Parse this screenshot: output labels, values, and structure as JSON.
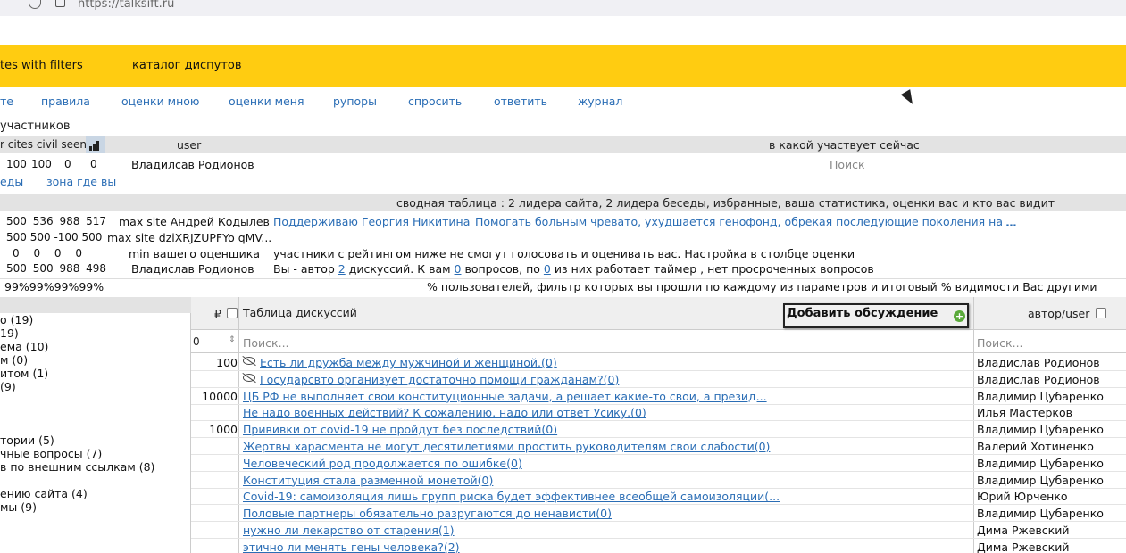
{
  "browser": {
    "url": "https://talksift.ru"
  },
  "header": {
    "item1": "tes with filters",
    "item2": "каталог диспутов"
  },
  "nav": [
    "те",
    "правила",
    "оценки мною",
    "оценки меня",
    "рупоры",
    "спросить",
    "ответить",
    "журнал"
  ],
  "participants_label": "участников",
  "stats_header": {
    "cols": "r cites civil seen",
    "user": "user",
    "current": "в какой участвует сейчас"
  },
  "stats_row": {
    "v1": "100",
    "v2": "100",
    "v3": "0",
    "v4": "0",
    "user": "Владилсав Родионов",
    "search_placeholder": "Поиск"
  },
  "subnav": {
    "a": "еды",
    "b": "зона где вы"
  },
  "summary_title": "сводная таблица : 2 лидера сайта, 2 лидера беседы, избранные, ваша статистика, оценки вас и кто вас видит",
  "summary_rows": [
    {
      "nums": "500 536 988 517",
      "label": "max site Андрей Кодылев",
      "link1": "Поддерживаю Георгия Никитина",
      "link2": "Помогать больным чревато, ухудшается генофонд, обрекая последующие поколения на ...",
      "link3": "..."
    },
    {
      "nums": "500 500 -100 500",
      "label": "max site dziXRJZUPFYo qMV..."
    },
    {
      "nums": "0 0 0 0",
      "label": "min вашего оценщика",
      "text": "участники с рейтингом ниже не смогут голосовать и оценивать вас. Настройка в столбце оценки"
    },
    {
      "nums": "500 500 988 498",
      "label": "Владислав Родионов",
      "text_a": "Вы - автор",
      "link_a": "2",
      "text_b": "дискуссий. К вам",
      "link_b": "0",
      "text_c": "вопросов, по",
      "link_c": "0",
      "text_d": "из них работает таймер , нет просроченных вопросов"
    }
  ],
  "percent_row": {
    "nums": "99%99%99%99%",
    "text": "% пользователей, фильтр которых вы прошли по каждому из параметров и итоговый % видимости Вас другими"
  },
  "tree": [
    "о (19)",
    "19)",
    "ема (10)",
    "м (0)",
    "итом (1)",
    " (9)",
    "",
    "",
    "тории (5)",
    "чные вопросы (7)",
    "в по внешним ссылкам (8)",
    "",
    "ению сайта (4)",
    "мы (9)"
  ],
  "table": {
    "currency_label": "₽",
    "title": "Таблица дискуссий",
    "add_button": "Добавить обсуждение",
    "author_label": "автор/user",
    "filter_value": "0",
    "search_placeholder": "Поиск...",
    "author_search_placeholder": "Поиск...",
    "rows": [
      {
        "amount": "100",
        "eye": true,
        "title": "Есть ли дружба между мужчиной и женщиной.(0)",
        "author": "Владислав Родионов"
      },
      {
        "amount": "",
        "eye": true,
        "title": "Государсвто организует достаточно помощи гражданам?(0)",
        "author": "Владислав Родионов"
      },
      {
        "amount": "10000",
        "eye": false,
        "title": "ЦБ РФ не выполняет свои конституционные задачи, а решает какие-то свои, а презид...",
        "author": "Владимир Цубаренко"
      },
      {
        "amount": "",
        "eye": false,
        "title": "Не надо военных действий? К сожалению, надо или ответ Усику.(0)",
        "author": "Илья Мастерков"
      },
      {
        "amount": "1000",
        "eye": false,
        "title": "Прививки от covid-19 не пройдут без последствий(0)",
        "author": "Владимир Цубаренко"
      },
      {
        "amount": "",
        "eye": false,
        "title": "Жертвы харасмента не могут десятилетиями простить руководителям свои слабости(0)",
        "author": "Валерий Хотиненко"
      },
      {
        "amount": "",
        "eye": false,
        "title": "Человеческий род продолжается по ошибке(0)",
        "author": "Владимир Цубаренко"
      },
      {
        "amount": "",
        "eye": false,
        "title": "Конституция стала разменной монетой(0)",
        "author": "Владимир Цубаренко"
      },
      {
        "amount": "",
        "eye": false,
        "title": "Covid-19: самоизоляция лишь групп риска будет эффективнее всеобщей самоизоляции(...",
        "author": "Юрий Юрченко"
      },
      {
        "amount": "",
        "eye": false,
        "title": "Половые партнеры обязательно разругаются до ненависти(0)",
        "author": "Владимир Цубаренко"
      },
      {
        "amount": "",
        "eye": false,
        "title": "нужно ли лекарство от старения(1)",
        "author": "Дима Ржевский"
      },
      {
        "amount": "",
        "eye": false,
        "title": "этично ли менять гены человека?(2)",
        "author": "Дима Ржевский"
      }
    ]
  }
}
